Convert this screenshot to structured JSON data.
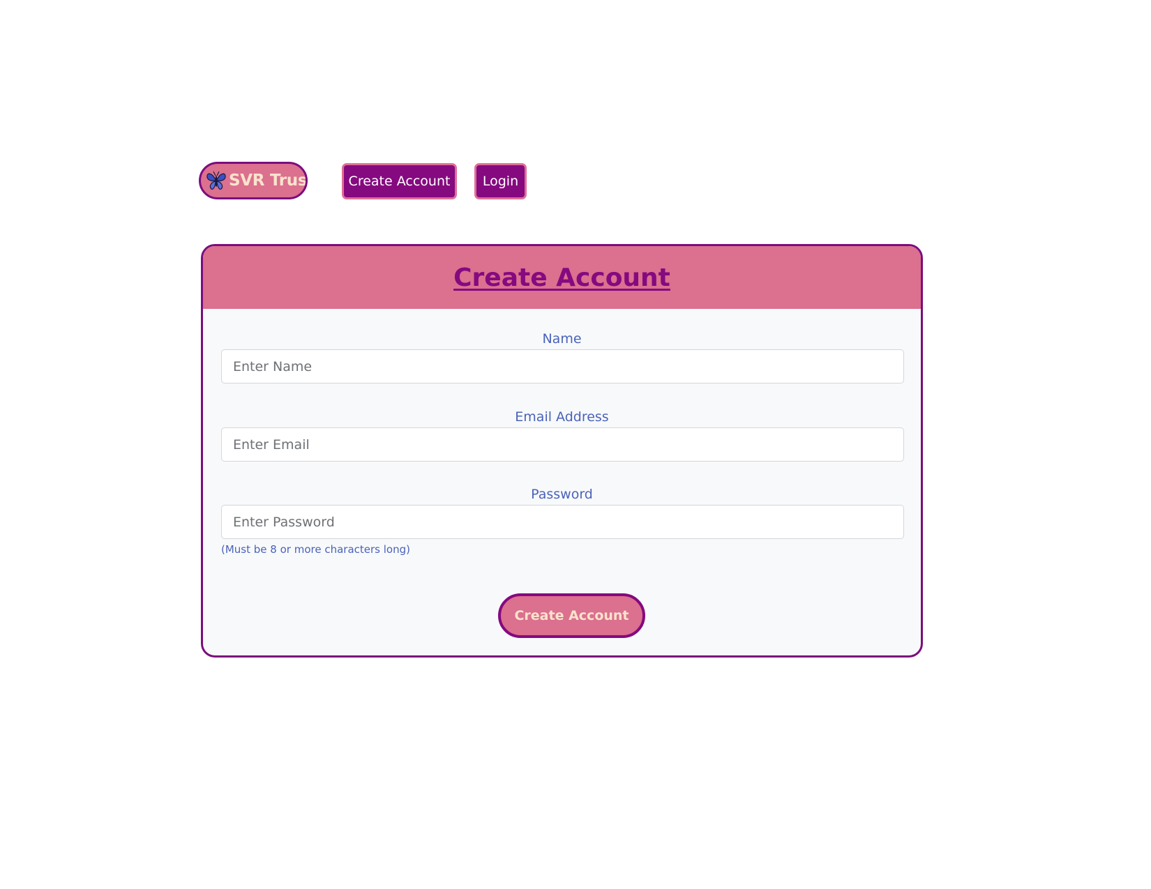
{
  "nav": {
    "brand_text": "SVR Trust",
    "brand_icon": "butterfly-icon",
    "create_account_label": "Create Account",
    "login_label": "Login"
  },
  "form": {
    "title": "Create Account",
    "name_label": "Name",
    "name_placeholder": "Enter Name",
    "email_label": "Email Address",
    "email_placeholder": "Enter Email",
    "password_label": "Password",
    "password_placeholder": "Enter Password",
    "password_hint": "(Must be 8 or more characters long)",
    "submit_label": "Create Account"
  },
  "colors": {
    "brand_pink": "#db708f",
    "brand_purple": "#85097f",
    "label_blue": "#4a63b8",
    "cream_text": "#fbe3cc"
  }
}
